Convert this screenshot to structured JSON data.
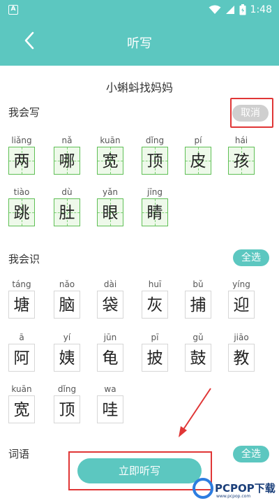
{
  "status_bar": {
    "time": "1:48",
    "app_icon": "A"
  },
  "header": {
    "title": "听写"
  },
  "lesson_title": "小蝌蚪找妈妈",
  "write_section": {
    "title": "我会写",
    "action_label": "取消",
    "rows": [
      [
        {
          "pinyin": "liǎng",
          "char": "两"
        },
        {
          "pinyin": "nǎ",
          "char": "哪"
        },
        {
          "pinyin": "kuān",
          "char": "宽"
        },
        {
          "pinyin": "dǐng",
          "char": "顶"
        },
        {
          "pinyin": "pí",
          "char": "皮"
        },
        {
          "pinyin": "hái",
          "char": "孩"
        }
      ],
      [
        {
          "pinyin": "tiào",
          "char": "跳"
        },
        {
          "pinyin": "dù",
          "char": "肚"
        },
        {
          "pinyin": "yǎn",
          "char": "眼"
        },
        {
          "pinyin": "jīng",
          "char": "睛"
        }
      ]
    ]
  },
  "read_section": {
    "title": "我会识",
    "action_label": "全选",
    "rows": [
      [
        {
          "pinyin": "táng",
          "char": "塘"
        },
        {
          "pinyin": "nǎo",
          "char": "脑"
        },
        {
          "pinyin": "dài",
          "char": "袋"
        },
        {
          "pinyin": "huī",
          "char": "灰"
        },
        {
          "pinyin": "bǔ",
          "char": "捕"
        },
        {
          "pinyin": "yíng",
          "char": "迎"
        }
      ],
      [
        {
          "pinyin": "ā",
          "char": "阿"
        },
        {
          "pinyin": "yí",
          "char": "姨"
        },
        {
          "pinyin": "jūn",
          "char": "龟"
        },
        {
          "pinyin": "pī",
          "char": "披"
        },
        {
          "pinyin": "gǔ",
          "char": "鼓"
        },
        {
          "pinyin": "jiāo",
          "char": "教"
        }
      ],
      [
        {
          "pinyin": "kuān",
          "char": "宽"
        },
        {
          "pinyin": "dǐng",
          "char": "顶"
        },
        {
          "pinyin": "wa",
          "char": "哇"
        }
      ]
    ]
  },
  "words_section": {
    "title": "词语",
    "action_label": "全选"
  },
  "start_button_label": "立即听写",
  "watermark": {
    "text": "PCPOP下载",
    "sub": "www.pcpop.com"
  },
  "colors": {
    "teal": "#5cc7c0",
    "highlight_red": "#e03636",
    "grid_green": "#5fbf55"
  },
  "icons": [
    "back-arrow-icon",
    "wifi-icon",
    "signal-icon",
    "battery-icon"
  ]
}
